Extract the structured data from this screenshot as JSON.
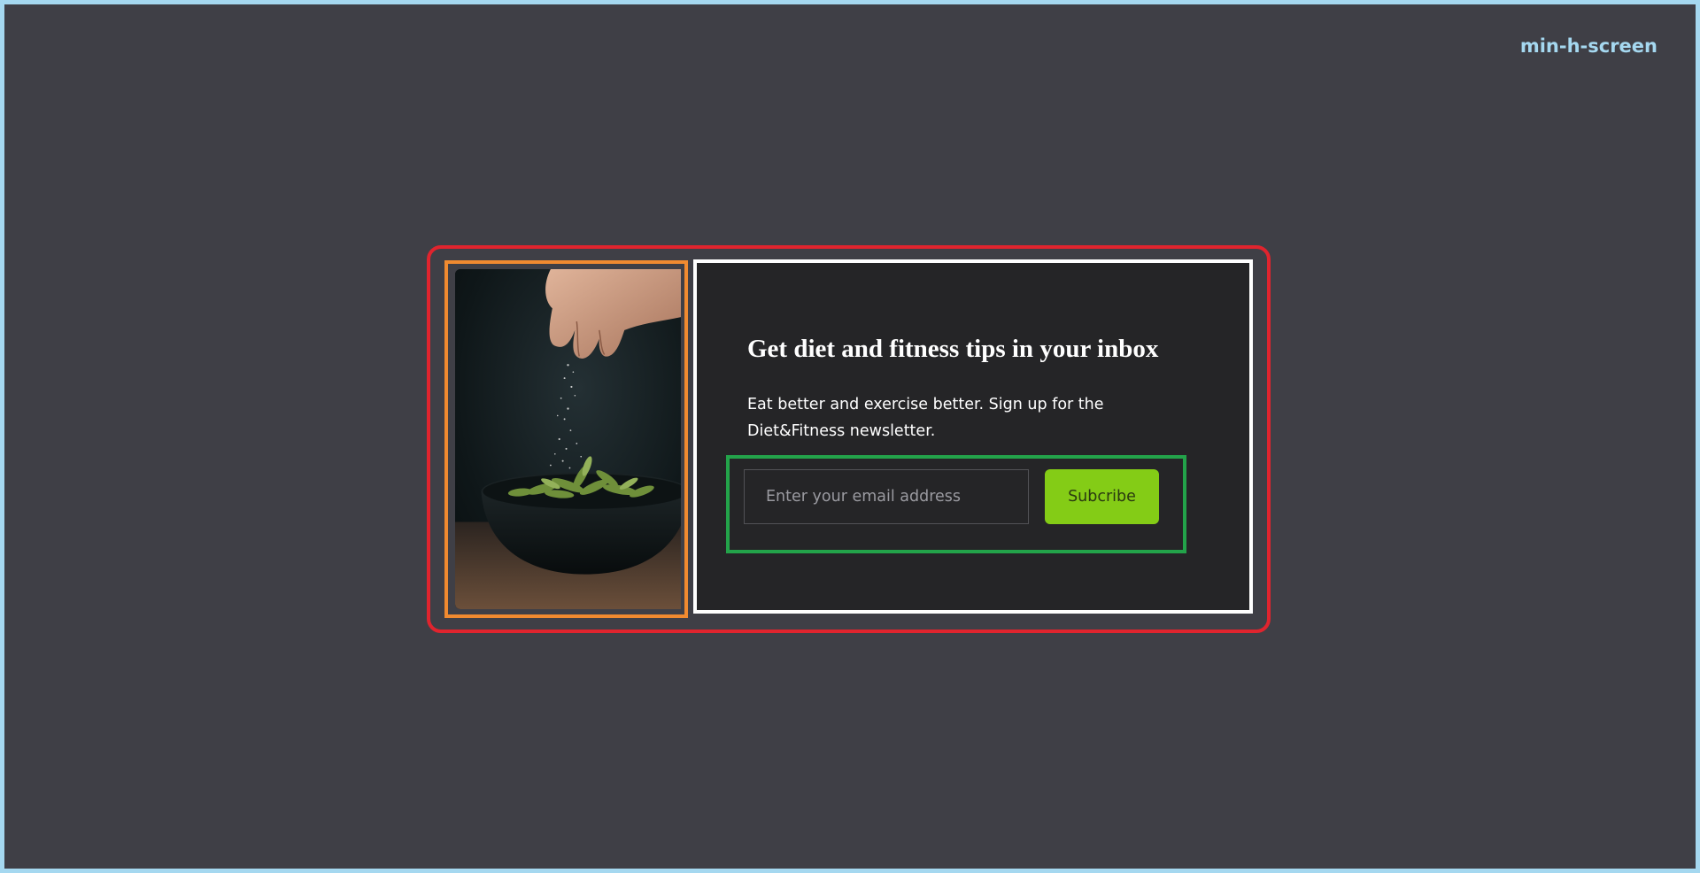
{
  "screen": {
    "label": "min-h-screen"
  },
  "newsletter": {
    "heading": "Get diet and fitness tips in your inbox",
    "description": "Eat better and exercise better. Sign up for the Diet&Fitness newsletter.",
    "email_placeholder": "Enter your email address",
    "email_value": "",
    "subscribe_label": "Subcribe"
  },
  "image": {
    "subject": "hand sprinkling salt over a bowl of edamame"
  },
  "colors": {
    "background": "#3f3f46",
    "panel": "#252527",
    "accent_button": "#84cc16",
    "screen_outline": "#a5d8f0",
    "card_outline": "#e0242e",
    "image_outline": "#f08a30",
    "form_outline": "#23a34a",
    "panel_outline": "#ffffff"
  }
}
